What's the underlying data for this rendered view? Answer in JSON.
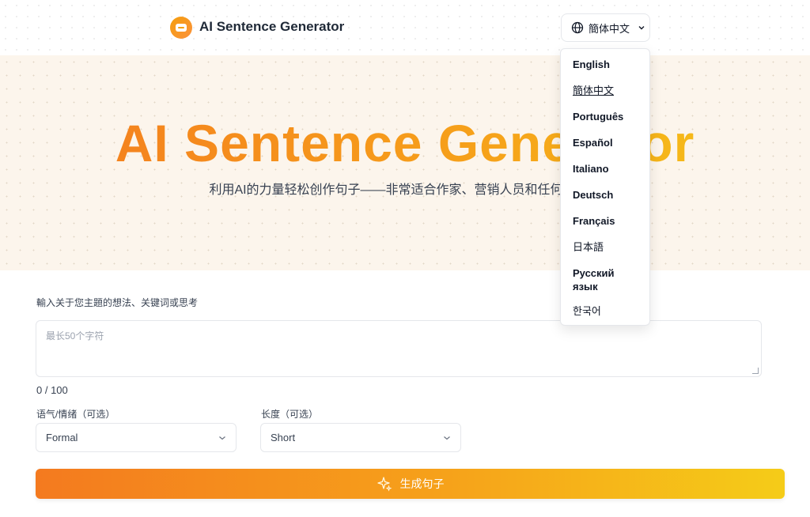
{
  "header": {
    "brand": "AI Sentence Generator",
    "language_button": "簡体中文"
  },
  "hero": {
    "title": "AI Sentence Generator",
    "subtitle": "利用AI的力量轻松创作句子——非常适合作家、营销人员和任何创作者"
  },
  "form": {
    "idea_label": "輸入关于您主題的想法、关键词或思考",
    "idea_placeholder": "最长50个字符",
    "counter": "0 / 100",
    "tone_label": "语气/情绪（可选）",
    "tone_value": "Formal",
    "length_label": "长度（可选）",
    "length_value": "Short",
    "generate_button": "生成句子"
  },
  "language_menu": {
    "selected": "簡体中文",
    "options": [
      "English",
      "簡体中文",
      "Português",
      "Español",
      "Italiano",
      "Deutsch",
      "Français",
      "日本語",
      "Русский язык",
      "한국어"
    ]
  },
  "colors": {
    "accent_start": "#f47a1f",
    "accent_end": "#f5cc18",
    "hero_bg": "#fcf5ec"
  },
  "icons": [
    "logo-icon",
    "globe-icon",
    "chevron-down-icon",
    "sparkle-icon"
  ]
}
